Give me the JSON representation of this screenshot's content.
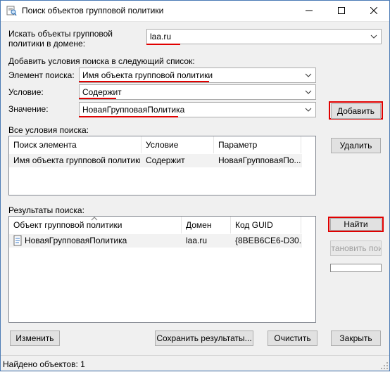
{
  "window": {
    "title": "Поиск объектов групповой политики",
    "minimize": "—",
    "maximize": "☐",
    "close": "✕"
  },
  "domain": {
    "label": "Искать объекты групповой политики в домене:",
    "value": "laa.ru"
  },
  "criteria": {
    "section_label": "Добавить условия поиска в следующий список:",
    "element_label": "Элемент поиска:",
    "element_value": "Имя объекта групповой политики",
    "condition_label": "Условие:",
    "condition_value": "Содержит",
    "value_label": "Значение:",
    "value_value": "НоваяГрупповаяПолитика",
    "add_button": "Добавить",
    "remove_button": "Удалить"
  },
  "conditions_list": {
    "label": "Все условия поиска:",
    "columns": [
      "Поиск элемента",
      "Условие",
      "Параметр"
    ],
    "rows": [
      [
        "Имя объекта групповой политики",
        "Содержит",
        "НоваяГрупповаяПо..."
      ]
    ]
  },
  "results": {
    "label": "Результаты поиска:",
    "columns": [
      "Объект групповой политики",
      "Домен",
      "Код GUID"
    ],
    "rows": [
      [
        "НоваяГрупповаяПолитика",
        "laa.ru",
        "{8BEB6CE6-D30..."
      ]
    ],
    "find_button": "Найти",
    "stop_button": ":тановить пои"
  },
  "bottom": {
    "edit_button": "Изменить",
    "save_button": "Сохранить результаты...",
    "clear_button": "Очистить",
    "close_button": "Закрыть"
  },
  "status": {
    "text": "Найдено объектов: 1"
  },
  "colors": {
    "highlight": "#e00000"
  }
}
